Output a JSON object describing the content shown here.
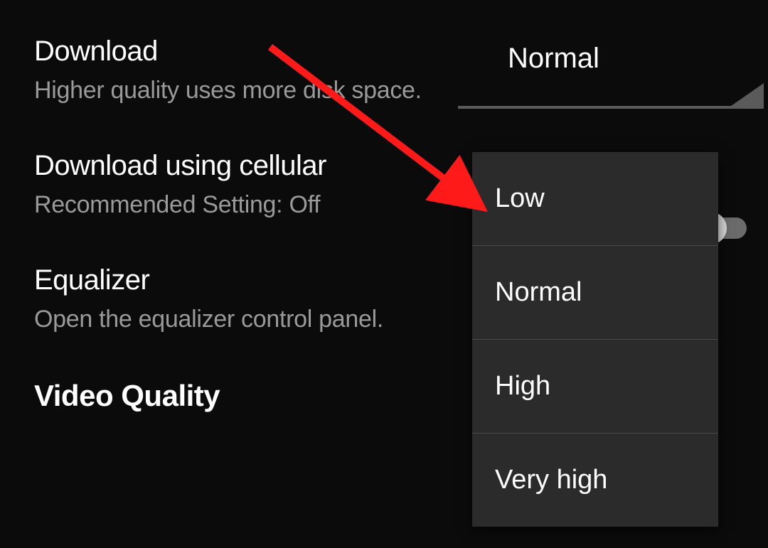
{
  "settings": {
    "download": {
      "title": "Download",
      "subtitle": "Higher quality uses more disk space.",
      "current_value": "Normal"
    },
    "download_cellular": {
      "title": "Download using cellular",
      "subtitle": "Recommended Setting: Off",
      "toggle_state": "off"
    },
    "equalizer": {
      "title": "Equalizer",
      "subtitle": "Open the equalizer control panel."
    },
    "video_quality_heading": "Video Quality"
  },
  "dropdown": {
    "options": [
      "Low",
      "Normal",
      "High",
      "Very high"
    ]
  },
  "annotation_arrow_color": "#ff1a1a"
}
